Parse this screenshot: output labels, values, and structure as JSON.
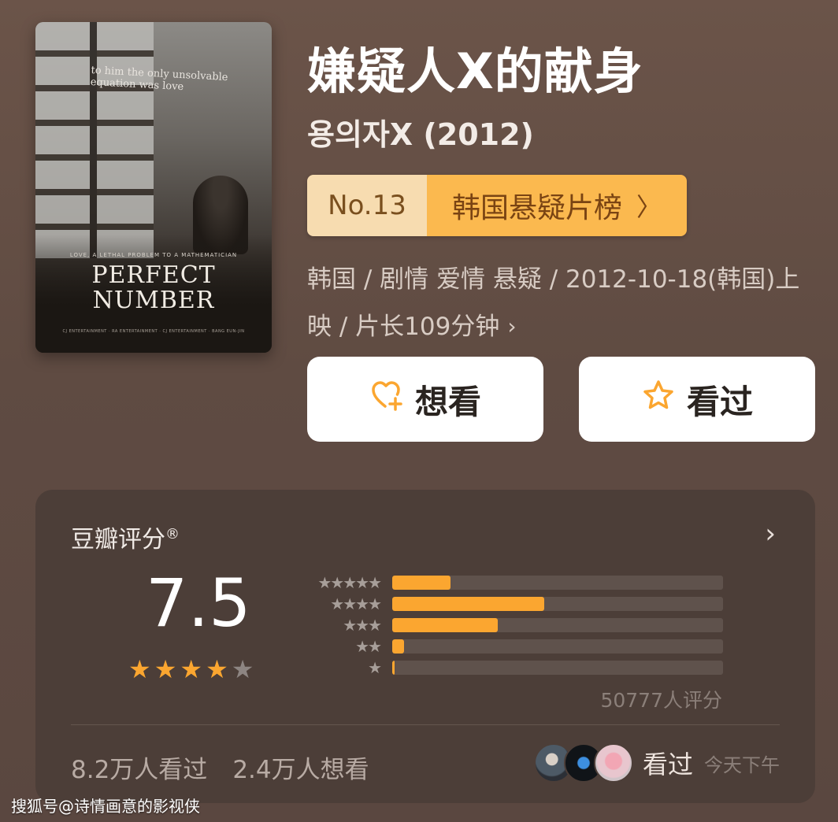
{
  "poster": {
    "tagline": "to him the only unsolvable equation was love",
    "subline": "LOVE, A LETHAL PROBLEM TO A MATHEMATICIAN",
    "title_line1": "PERFECT",
    "title_line2": "NUMBER",
    "credits": "CJ ENTERTAINMENT · RA ENTERTAINMENT · CJ ENTERTAINMENT · BANG EUN-JIN"
  },
  "movie": {
    "title": "嫌疑人X的献身",
    "original_title": "용의자X (2012)",
    "rank_no": "No.13",
    "rank_list": "韩国悬疑片榜",
    "meta_line1": "韩国 / 剧情 爱情 悬疑 / 2012-10-18(韩国)上",
    "meta_line2": "映 / 片长109分钟"
  },
  "actions": {
    "want_label": "想看",
    "seen_label": "看过"
  },
  "rating": {
    "header": "豆瓣评分",
    "registered": "®",
    "score": "7.5",
    "stars_full": 4,
    "rating_count": "50777人评分",
    "distribution": [
      {
        "stars": "★★★★★",
        "percent": 17.5
      },
      {
        "stars": "★★★★",
        "percent": 46
      },
      {
        "stars": "★★★",
        "percent": 32
      },
      {
        "stars": "★★",
        "percent": 3.5
      },
      {
        "stars": "★",
        "percent": 0.7
      }
    ],
    "watched": "8.2万人看过",
    "wishlist": "2.4万人想看",
    "friends_label": "看过",
    "friends_time": "今天下午"
  },
  "icons": {
    "want": "heart-plus-icon",
    "seen": "star-outline-icon",
    "accent": "#fba630"
  },
  "watermark": "搜狐号@诗情画意的影视侠"
}
